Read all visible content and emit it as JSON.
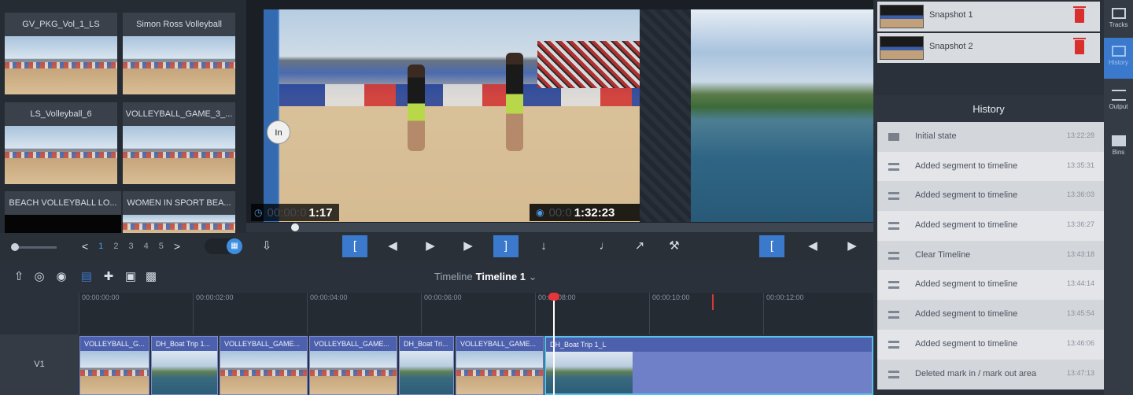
{
  "bin": {
    "clips": [
      {
        "name": "GV_PKG_Vol_1_LS",
        "thumb": "beach"
      },
      {
        "name": "Simon Ross Volleyball",
        "thumb": "beach"
      },
      {
        "name": "LS_Volleyball_6",
        "thumb": "beach"
      },
      {
        "name": "VOLLEYBALL_GAME_3_...",
        "thumb": "beach"
      },
      {
        "name": "BEACH VOLLEYBALL LO...",
        "thumb": "black"
      },
      {
        "name": "WOMEN IN SPORT BEA...",
        "thumb": "beach"
      }
    ],
    "pager": {
      "prev": "<",
      "pages": [
        "1",
        "2",
        "3",
        "4",
        "5"
      ],
      "current": "1",
      "next": ">"
    }
  },
  "player": {
    "in_badge": "In",
    "source_tc_dim": "00:00:0",
    "source_tc": "1:17",
    "record_tc_dim": "00:0",
    "record_tc": "1:32:23",
    "scrub_position": 0.075
  },
  "transport": {
    "buttons": [
      "snapshot-icon",
      "mark-in",
      "step-back",
      "play",
      "step-forward",
      "mark-out",
      "insert-down",
      "volume",
      "fullscreen",
      "settings-wrench",
      "mark-in-2",
      "step-back-2",
      "play-2"
    ]
  },
  "timeline": {
    "title_prefix": "Timeline",
    "title_name": "Timeline 1",
    "ticks": [
      "00:00:00:00",
      "00:00:02:00",
      "00:00:04:00",
      "00:00:06:00",
      "00:00:08:00",
      "00:00:10:00",
      "00:00:12:00"
    ],
    "track_label": "V1",
    "segments": [
      {
        "name": "VOLLEYBALL_G...",
        "thumb": "beach"
      },
      {
        "name": "DH_Boat Trip 1...",
        "thumb": "sea"
      },
      {
        "name": "VOLLEYBALL_GAME...",
        "thumb": "beach"
      },
      {
        "name": "VOLLEYBALL_GAME...",
        "thumb": "beach"
      },
      {
        "name": "DH_Boat Tri...",
        "thumb": "sea"
      },
      {
        "name": "VOLLEYBALL_GAME...",
        "thumb": "beach"
      },
      {
        "name": "DH_Boat Trip 1_L",
        "thumb": "sea"
      }
    ]
  },
  "snapshots": [
    {
      "label": "Snapshot 1"
    },
    {
      "label": "Snapshot 2"
    }
  ],
  "history": {
    "title": "History",
    "rows": [
      {
        "label": "Initial state",
        "time": "13:22:28",
        "icon": "doc"
      },
      {
        "label": "Added segment to timeline",
        "time": "13:35:31",
        "icon": "segment"
      },
      {
        "label": "Added segment to timeline",
        "time": "13:36:03",
        "icon": "segment"
      },
      {
        "label": "Added segment to timeline",
        "time": "13:36:27",
        "icon": "segment"
      },
      {
        "label": "Clear Timeline",
        "time": "13:43:18",
        "icon": "segment"
      },
      {
        "label": "Added segment to timeline",
        "time": "13:44:14",
        "icon": "segment"
      },
      {
        "label": "Added segment to timeline",
        "time": "13:45:54",
        "icon": "segment"
      },
      {
        "label": "Added segment to timeline",
        "time": "13:46:06",
        "icon": "segment"
      },
      {
        "label": "Deleted mark in / mark out area",
        "time": "13:47:13",
        "icon": "segment"
      }
    ]
  },
  "rail": [
    {
      "label": "Tracks",
      "active": false
    },
    {
      "label": "History",
      "active": true
    },
    {
      "label": "Output",
      "active": false
    },
    {
      "label": "Bins",
      "active": false
    }
  ],
  "colors": {
    "accent": "#3b79cc",
    "playhead": "#e8353b",
    "segment": "#5c6fb7"
  }
}
